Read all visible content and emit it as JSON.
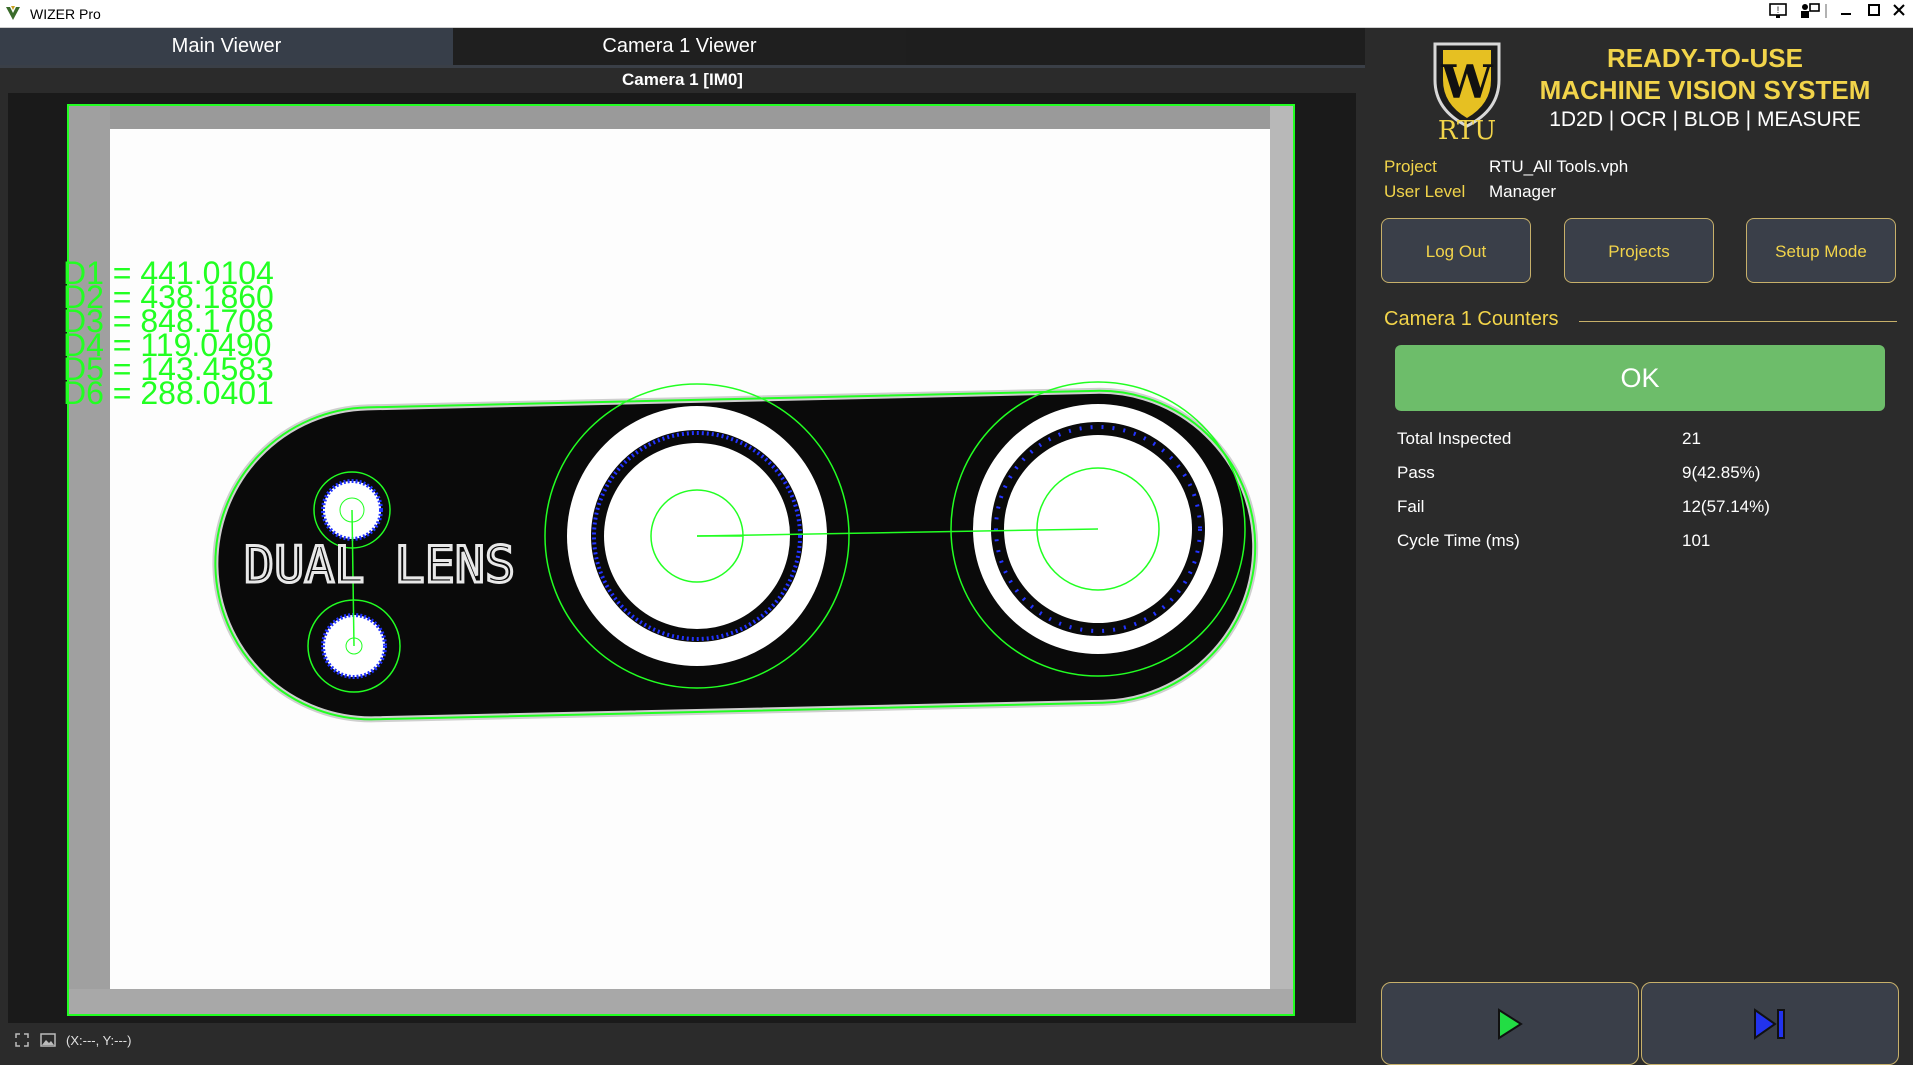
{
  "window": {
    "title": "WIZER Pro"
  },
  "tabs": [
    {
      "label": "Main Viewer",
      "active": true
    },
    {
      "label": "Camera 1 Viewer",
      "active": false
    }
  ],
  "viewer": {
    "camera_title": "Camera 1  [IM0]",
    "part_text": "DUAL LENS",
    "measurements": [
      "D1 = 441.0104",
      "D2 = 438.1860",
      "D3 = 848.1708",
      "D4 = 119.0490",
      "D5 = 143.4583",
      "D6 = 288.0401"
    ],
    "overlay_color": "#22ff22",
    "edge_point_color": "#2233ff"
  },
  "status": {
    "coordinates": "(X:---, Y:---)"
  },
  "brand": {
    "logo_letter": "W",
    "logo_text": "RTU",
    "line1": "READY-TO-USE",
    "line2": "MACHINE VISION SYSTEM",
    "line3": "1D2D | OCR | BLOB | MEASURE",
    "accent_color": "#f2d44a"
  },
  "info": {
    "project_label": "Project",
    "project_value": "RTU_All Tools.vph",
    "user_label": "User Level",
    "user_value": "Manager"
  },
  "buttons": {
    "logout": "Log Out",
    "projects": "Projects",
    "setup": "Setup Mode"
  },
  "counters": {
    "title": "Camera 1 Counters",
    "result": "OK",
    "result_color": "#6dbd6a",
    "rows": [
      {
        "label": "Total Inspected",
        "value": "21"
      },
      {
        "label": "Pass",
        "value": "9(42.85%)"
      },
      {
        "label": "Fail",
        "value": "12(57.14%)"
      },
      {
        "label": "Cycle Time (ms)",
        "value": "101"
      }
    ]
  },
  "controls": {
    "run_icon": "play-icon",
    "step_icon": "step-forward-icon"
  }
}
